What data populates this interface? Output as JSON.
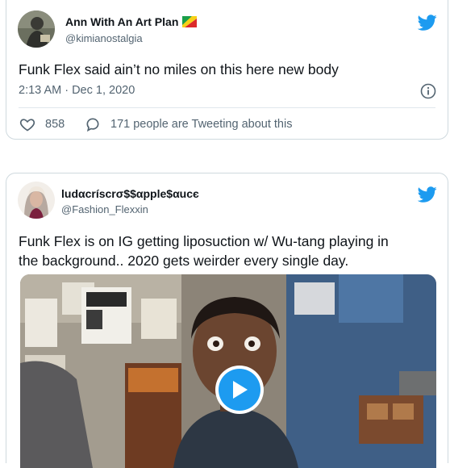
{
  "tweets": [
    {
      "display_name": "Ann With An Art Plan",
      "flag": "flag-icon",
      "handle": "@kimianostalgia",
      "text": "Funk Flex said ain’t no miles on this here new body",
      "timestamp": "2:13 AM · Dec 1, 2020",
      "likes": "858",
      "activity": "171 people are Tweeting about this"
    },
    {
      "display_name": "ludαcríscrσ$$αpple$αucє",
      "handle": "@Fashion_Flexxin",
      "text_line1": "Funk Flex is on IG getting liposuction w/ Wu-tang playing in",
      "text_line2": "the background.. 2020 gets weirder every single day.",
      "media_type": "video"
    }
  ],
  "colors": {
    "twitter_blue": "#1d9bf0",
    "secondary_text": "#536471",
    "border": "#cfd9de"
  }
}
